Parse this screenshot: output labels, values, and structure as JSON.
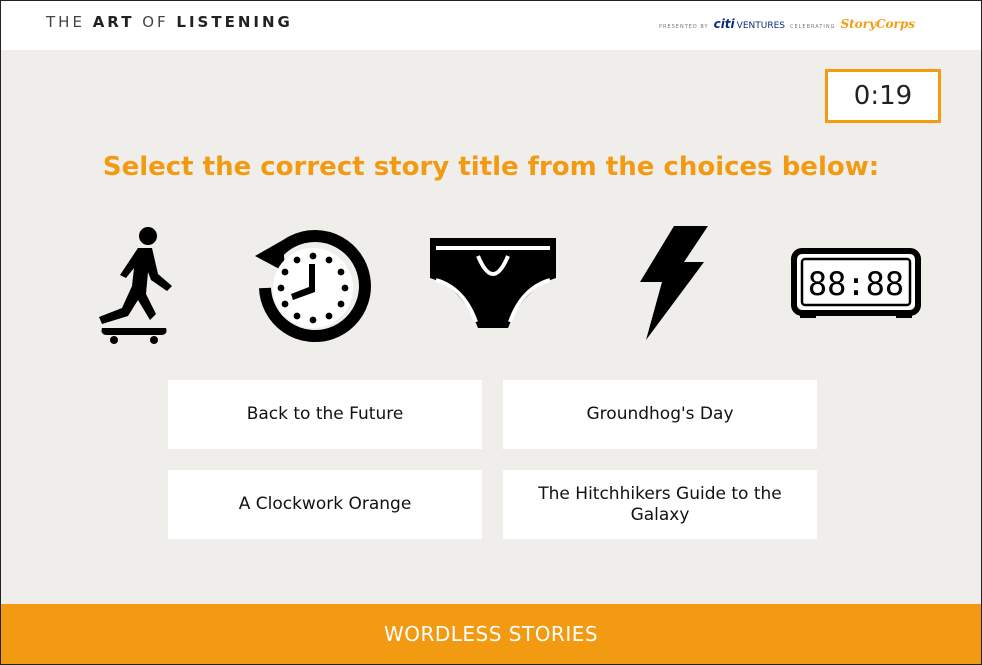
{
  "header": {
    "brand_the": "THE",
    "brand_art": "ART",
    "brand_of": "OF",
    "brand_listening": "LISTENING",
    "presented_by": "PRESENTED BY",
    "citi": "citi",
    "ventures": "VENTURES",
    "celebrating": "CELEBRATING",
    "storycorps": "StoryCorps"
  },
  "timer": {
    "value": "0:19"
  },
  "prompt": "Select the correct story title from the choices below:",
  "icons": [
    "skateboarder-icon",
    "clock-rewind-icon",
    "underwear-briefs-icon",
    "lightning-bolt-icon",
    "digital-clock-icon"
  ],
  "digital_clock_text": "88:88",
  "choices": [
    "Back to the Future",
    "Groundhog's Day",
    "A Clockwork Orange",
    "The Hitchhikers Guide to the Galaxy"
  ],
  "footer": {
    "label": "WORDLESS STORIES"
  },
  "colors": {
    "accent": "#f29a11",
    "background": "#efeeeb",
    "card": "#ffffff"
  }
}
